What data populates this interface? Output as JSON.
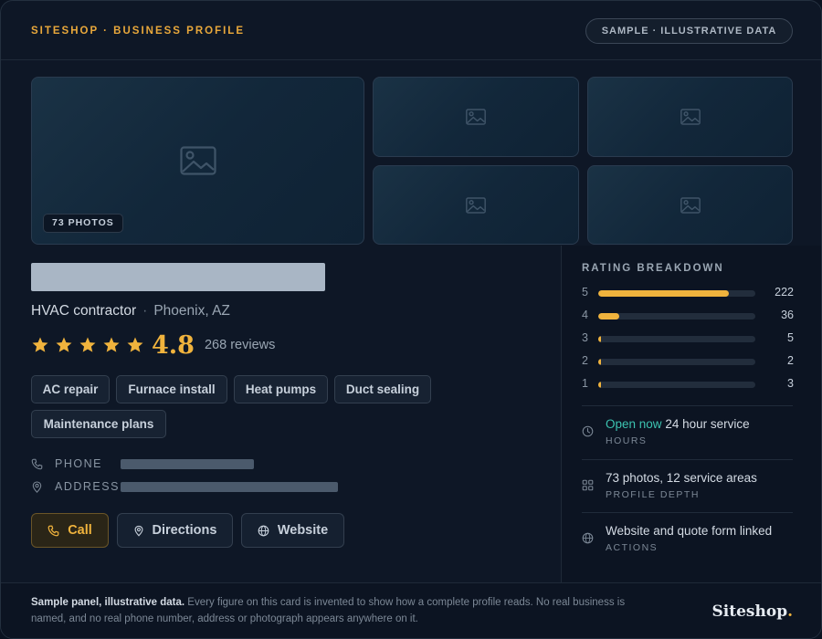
{
  "header": {
    "brand": "SITESHOP · BUSINESS PROFILE",
    "sample_badge": "SAMPLE · ILLUSTRATIVE DATA"
  },
  "gallery": {
    "photo_count": "73 PHOTOS"
  },
  "business": {
    "category": "HVAC contractor",
    "location": "Phoenix, AZ",
    "rating": "4.8",
    "stars_filled": 5,
    "reviews": "268 reviews"
  },
  "tags": [
    "AC repair",
    "Furnace install",
    "Heat pumps",
    "Duct sealing",
    "Maintenance plans"
  ],
  "contact": {
    "phone_label": "PHONE",
    "address_label": "ADDRESS"
  },
  "actions": {
    "call": "Call",
    "directions": "Directions",
    "website": "Website"
  },
  "breakdown": {
    "title": "RATING BREAKDOWN",
    "rows": [
      {
        "star": "5",
        "count": "222",
        "fraction": 0.829
      },
      {
        "star": "4",
        "count": "36",
        "fraction": 0.134
      },
      {
        "star": "3",
        "count": "5",
        "fraction": 0.019
      },
      {
        "star": "2",
        "count": "2",
        "fraction": 0.007
      },
      {
        "star": "1",
        "count": "3",
        "fraction": 0.011
      }
    ]
  },
  "info": {
    "hours_open": "Open now",
    "hours_detail": "24 hour service",
    "hours_label": "HOURS",
    "depth_main": "73 photos, 12 service areas",
    "depth_label": "PROFILE DEPTH",
    "actions_main": "Website and quote form linked",
    "actions_label": "ACTIONS"
  },
  "footer": {
    "lead": "Sample panel, illustrative data.",
    "text": "Every figure on this card is invented to show how a complete profile reads. No real business is named, and no real phone number, address or photograph appears anywhere on it.",
    "logo": "Siteshop",
    "logo_dot": "."
  },
  "colors": {
    "accent": "#f0b33d",
    "open": "#3cc3b0",
    "background": "#0e1726"
  }
}
